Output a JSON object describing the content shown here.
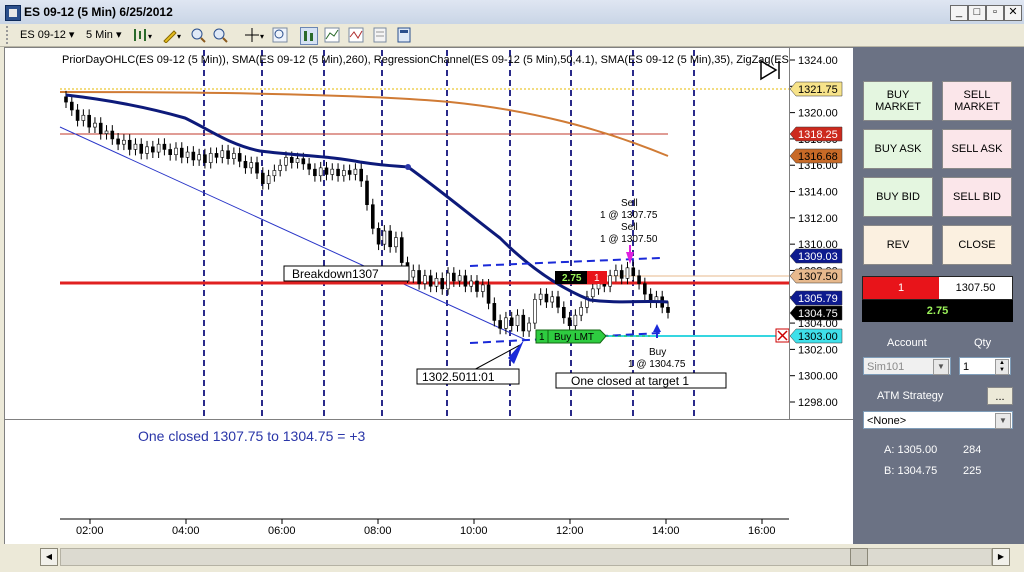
{
  "window": {
    "title": "ES 09-12 (5 Min)  6/25/2012"
  },
  "toolbar": {
    "instrument": "ES 09-12",
    "interval": "5 Min"
  },
  "chart": {
    "indicators_label": "PriorDayOHLC(ES 09-12 (5 Min)), SMA(ES 09-12 (5 Min),260), RegressionChannel(ES 09-12 (5 Min),50,4.1), SMA(ES 09-12 (5 Min),35), ZigZag(ES",
    "price_ticks": [
      "1324.00",
      "1322.00",
      "1320.00",
      "1318.00",
      "1316.00",
      "1314.00",
      "1312.00",
      "1310.00",
      "1308.00",
      "1306.00",
      "1304.00",
      "1302.00",
      "1300.00",
      "1298.00"
    ],
    "time_ticks": [
      "02:00",
      "04:00",
      "06:00",
      "08:00",
      "10:00",
      "12:00",
      "14:00",
      "16:00"
    ],
    "price_tags": [
      {
        "text": "1321.75",
        "bg": "#f7e38a",
        "fg": "#000"
      },
      {
        "text": "1318.25",
        "bg": "#cc2a1e",
        "fg": "#fff"
      },
      {
        "text": "1316.68",
        "bg": "#c86a27",
        "fg": "#000"
      },
      {
        "text": "1309.03",
        "bg": "#0d1a8e",
        "fg": "#fff"
      },
      {
        "text": "1307.50",
        "bg": "#e7b98d",
        "fg": "#000"
      },
      {
        "text": "1305.79",
        "bg": "#0d1a8e",
        "fg": "#fff"
      },
      {
        "text": "1304.75",
        "bg": "#000000",
        "fg": "#fff"
      },
      {
        "text": "1303.00",
        "bg": "#3fe0ea",
        "fg": "#000"
      }
    ],
    "annotations": {
      "breakdown": "Breakdown1307",
      "low_label": "1302.5011:01",
      "target_label": "One closed at target 1",
      "sell1": "Sell",
      "sell1_detail": "1 @ 1307.75",
      "sell2": "Sell",
      "sell2_detail": "1 @ 1307.50",
      "buy": "Buy",
      "buy_detail": "1 @ 1304.75",
      "pos_pnl": "2.75",
      "pos_qty": "1",
      "buy_lmt_qty": "1",
      "buy_lmt": "Buy LMT",
      "summary": "One closed 1307.75 to 1304.75 = +3"
    },
    "colors": {
      "sma260": "#d07b35",
      "sma35": "#0d1a7a",
      "breakdown_line": "#e02020",
      "target_line": "#35d6e0",
      "prior_high": "#c0392b"
    }
  },
  "panel": {
    "buy_market": "BUY\nMARKET",
    "sell_market": "SELL\nMARKET",
    "buy_ask": "BUY ASK",
    "sell_ask": "SELL ASK",
    "buy_bid": "BUY BID",
    "sell_bid": "SELL BID",
    "rev": "REV",
    "close": "CLOSE",
    "position_qty": "1",
    "position_price": "1307.50",
    "position_pnl": "2.75",
    "account_label": "Account",
    "qty_label": "Qty",
    "account_value": "Sim101",
    "qty_value": "1",
    "atm_label": "ATM Strategy",
    "atm_more": "...",
    "atm_value": "<None>",
    "ask_label": "A: 1305.00",
    "ask_size": "284",
    "bid_label": "B: 1304.75",
    "bid_size": "225"
  }
}
